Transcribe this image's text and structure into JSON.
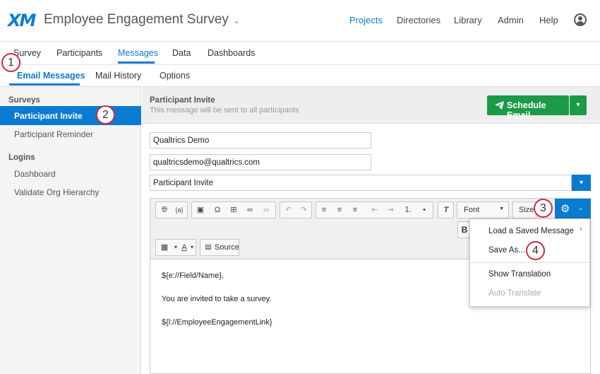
{
  "header": {
    "logo": "XM",
    "title": "Employee Engagement Survey",
    "title_chevron": "⌄",
    "nav": [
      "Projects",
      "Directories",
      "Library",
      "Admin",
      "Help"
    ]
  },
  "tabs": [
    "Survey",
    "Participants",
    "Messages",
    "Data",
    "Dashboards"
  ],
  "subtabs": [
    "Email Messages",
    "Mail History",
    "Options"
  ],
  "sidebar": {
    "surveys_heading": "Surveys",
    "survey_items": [
      "Participant Invite",
      "Participant Reminder"
    ],
    "logins_heading": "Logins",
    "login_items": [
      "Dashboard",
      "Validate Org Hierarchy"
    ]
  },
  "message": {
    "title": "Participant Invite",
    "subtitle": "This message will be sent to all participants",
    "schedule_label": "Schedule Email",
    "from_name": "Qualtrics Demo",
    "from_email": "qualtricsdemo@qualtrics.com",
    "subject": "Participant Invite"
  },
  "toolbar": {
    "font_label": "Font",
    "size_label": "Size",
    "source_label": "Source",
    "bold_label": "B"
  },
  "body_lines": [
    "${e://Field/Name},",
    "You are invited to take a survey.",
    "${l://EmployeeEngagementLink}"
  ],
  "menu": {
    "items": [
      "Load a Saved Message",
      "Save As...",
      "Show Translation",
      "Auto Translate"
    ]
  },
  "markers": [
    "1",
    "2",
    "3",
    "4"
  ],
  "colors": {
    "accent": "#0b7bd1",
    "green": "#1c9a48",
    "marker": "#d6283a"
  }
}
